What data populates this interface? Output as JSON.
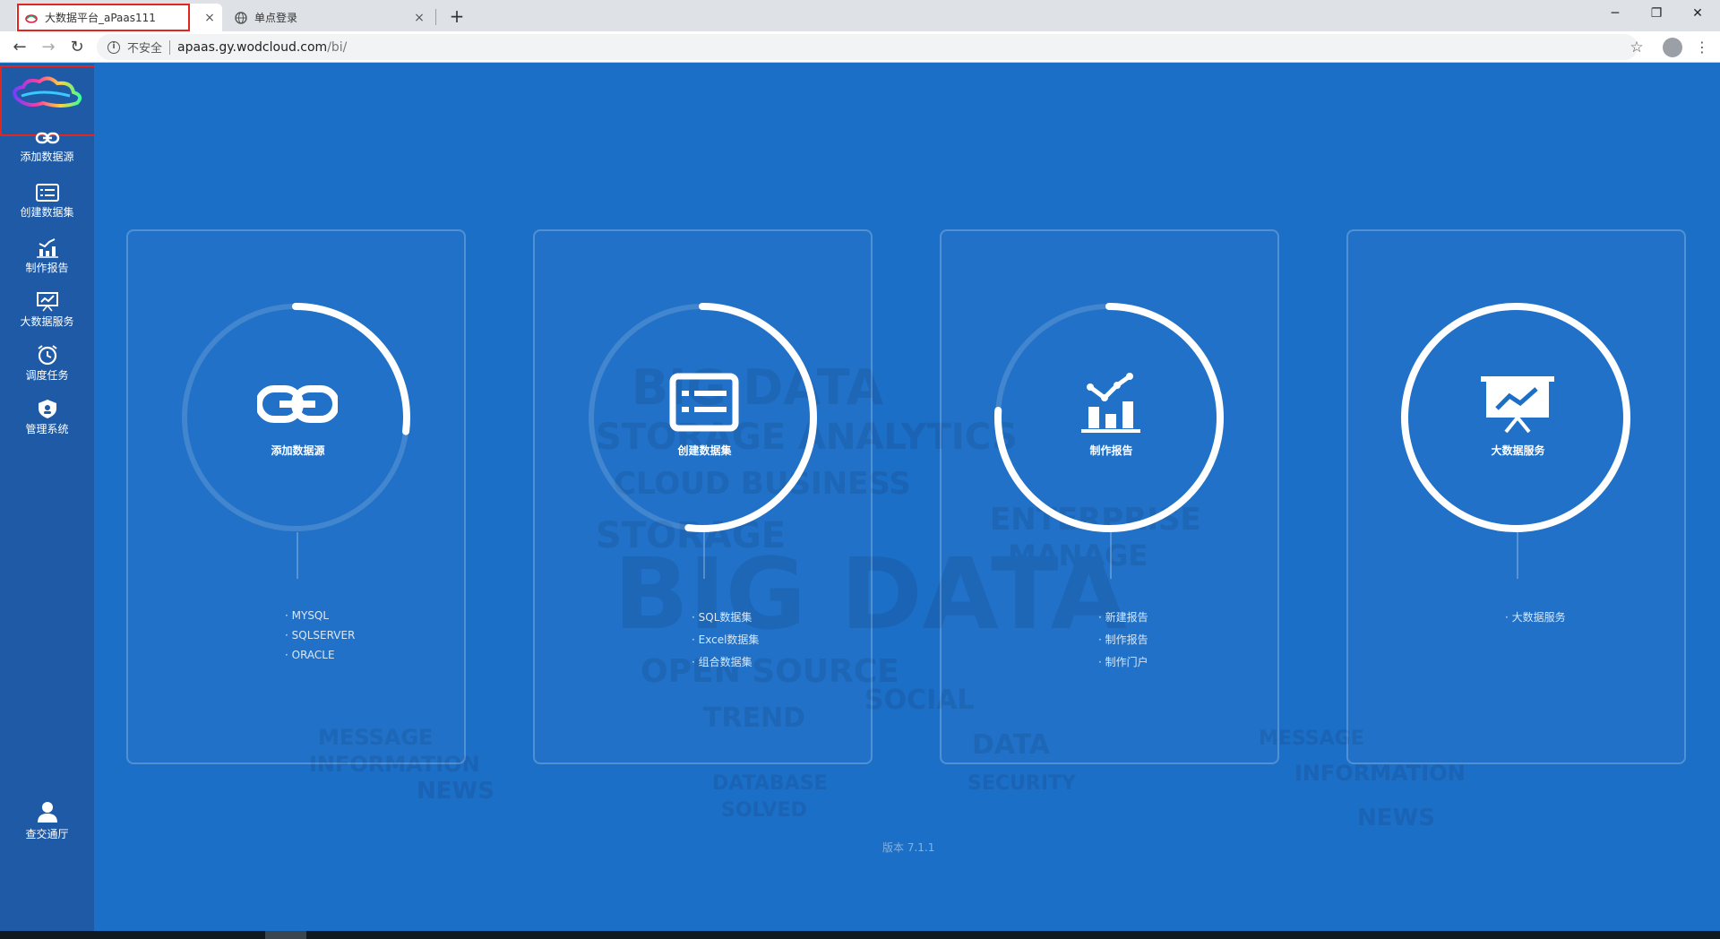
{
  "browser": {
    "tabs": [
      {
        "title": "大数据平台_aPaas111",
        "active": true
      },
      {
        "title": "单点登录",
        "active": false
      }
    ],
    "new_tab": "+",
    "close_glyph": "×",
    "window_controls": {
      "minimize": "─",
      "restore": "❐",
      "close": "✕"
    },
    "nav": {
      "back": "←",
      "forward": "→",
      "reload": "↻"
    },
    "address": {
      "security_label": "不安全",
      "host": "apaas.gy.wodcloud.com",
      "path": "/bi/"
    },
    "star": "☆",
    "menu": "⋮"
  },
  "sidebar": {
    "items": [
      {
        "label": "添加数据源",
        "icon": "link-icon"
      },
      {
        "label": "创建数据集",
        "icon": "list-icon"
      },
      {
        "label": "制作报告",
        "icon": "bar-chart-icon"
      },
      {
        "label": "大数据服务",
        "icon": "presentation-icon"
      },
      {
        "label": "调度任务",
        "icon": "alarm-clock-icon"
      },
      {
        "label": "管理系统",
        "icon": "shield-icon"
      }
    ],
    "bottom": {
      "label": "查交通厅",
      "icon": "user-icon"
    }
  },
  "cards": [
    {
      "title": "添加数据源",
      "icon": "link-icon",
      "progress": 0.27,
      "links": [
        "· MYSQL",
        "· SQLSERVER",
        "· ORACLE"
      ]
    },
    {
      "title": "创建数据集",
      "icon": "list-icon",
      "progress": 0.52,
      "links": [
        "· SQL数据集",
        "· Excel数据集",
        "· 组合数据集"
      ]
    },
    {
      "title": "制作报告",
      "icon": "bar-chart-icon",
      "progress": 0.76,
      "links": [
        "· 新建报告",
        "· 制作报告",
        "· 制作门户"
      ]
    },
    {
      "title": "大数据服务",
      "icon": "presentation-icon",
      "progress": 1.0,
      "links": [
        "· 大数据服务"
      ]
    }
  ],
  "version": "版本 7.1.1",
  "colors": {
    "background": "#1c6fc6",
    "sidebar": "#1e5aa6",
    "highlight": "#e0261f"
  }
}
